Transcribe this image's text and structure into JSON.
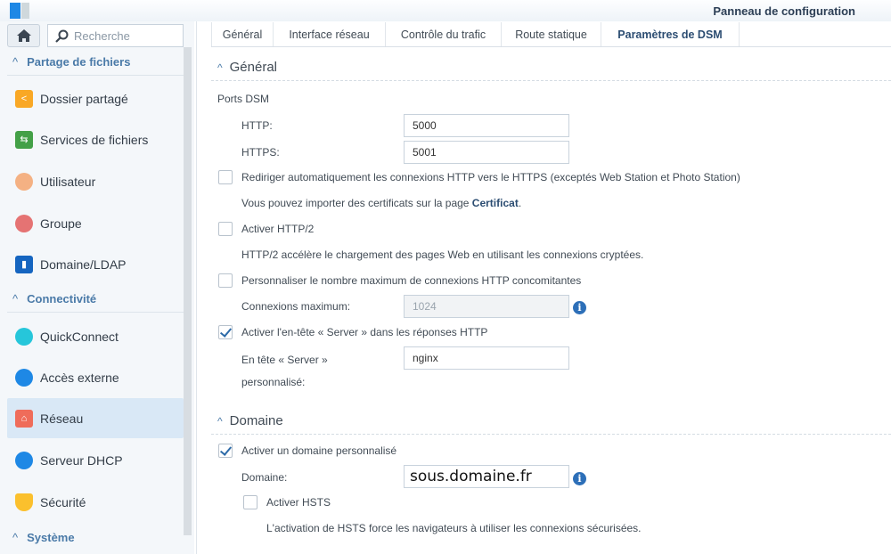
{
  "window": {
    "title": "Panneau de configuration"
  },
  "search": {
    "placeholder": "Recherche"
  },
  "sidebar": {
    "sections": [
      {
        "label": "Partage de fichiers",
        "items": [
          "Dossier partagé",
          "Services de fichiers",
          "Utilisateur",
          "Groupe",
          "Domaine/LDAP"
        ]
      },
      {
        "label": "Connectivité",
        "items": [
          "QuickConnect",
          "Accès externe",
          "Réseau",
          "Serveur DHCP",
          "Sécurité"
        ]
      },
      {
        "label": "Système",
        "items": []
      }
    ],
    "selected": "Réseau"
  },
  "tabs": [
    "Général",
    "Interface réseau",
    "Contrôle du trafic",
    "Route statique",
    "Paramètres de DSM"
  ],
  "active_tab": "Paramètres de DSM",
  "general": {
    "title": "Général",
    "ports_label": "Ports DSM",
    "http_label": "HTTP:",
    "http_value": "5000",
    "https_label": "HTTPS:",
    "https_value": "5001",
    "redirect_label": "Rediriger automatiquement les connexions HTTP vers le HTTPS (exceptés Web Station et Photo Station)",
    "redirect_checked": false,
    "cert_note_prefix": "Vous pouvez importer des certificats sur la page ",
    "cert_link": "Certificat",
    "cert_note_suffix": ".",
    "http2_label": "Activer HTTP/2",
    "http2_checked": false,
    "http2_note": "HTTP/2 accélère le chargement des pages Web en utilisant les connexions cryptées.",
    "maxconn_label": "Personnaliser le nombre maximum de connexions HTTP concomitantes",
    "maxconn_checked": false,
    "maxconn_field_label": "Connexions maximum:",
    "maxconn_value": "1024",
    "server_header_label": "Activer l'en-tête « Server » dans les réponses HTTP",
    "server_header_checked": true,
    "custom_header_label_1": "En tête « Server »",
    "custom_header_label_2": "personnalisé:",
    "custom_header_value": "nginx"
  },
  "domain": {
    "title": "Domaine",
    "enable_label": "Activer un domaine personnalisé",
    "enable_checked": true,
    "domain_label": "Domaine:",
    "domain_value": "sous.domaine.fr",
    "hsts_label": "Activer HSTS",
    "hsts_checked": false,
    "hsts_note": "L'activation de HSTS force les navigateurs à utiliser les connexions sécurisées."
  }
}
